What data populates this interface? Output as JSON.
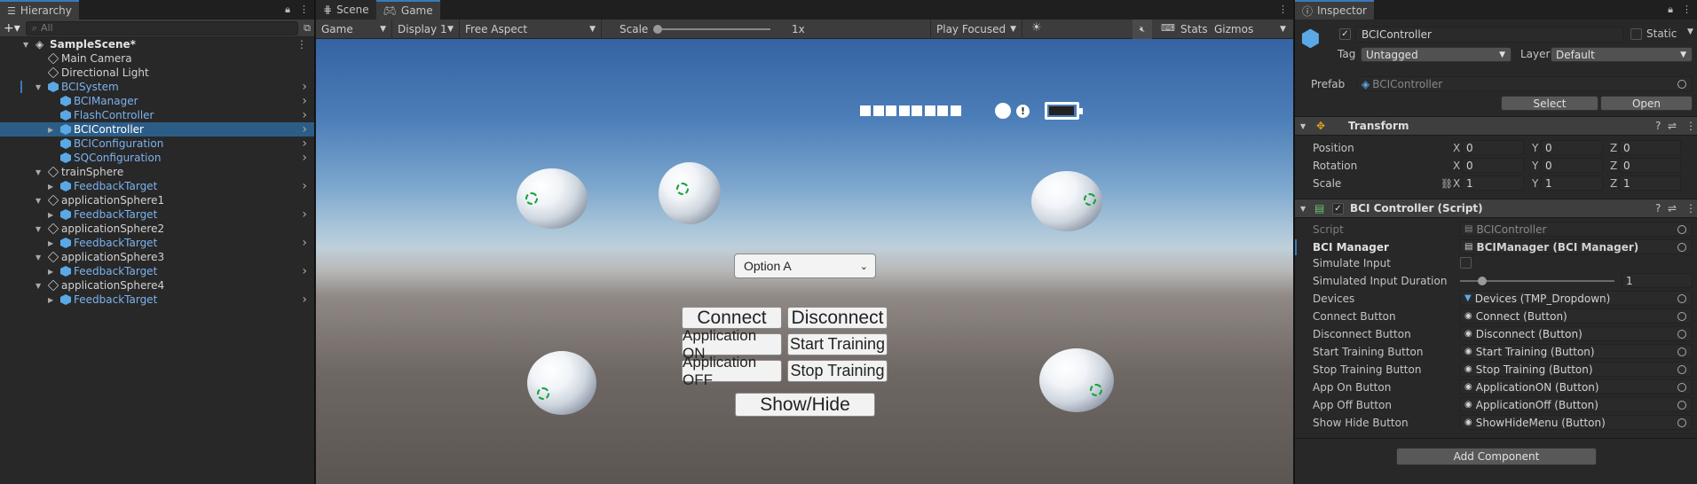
{
  "hierarchy": {
    "tab": "Hierarchy",
    "search_placeholder": "All",
    "scene": "SampleScene*",
    "items": [
      {
        "label": "Main Camera"
      },
      {
        "label": "Directional Light"
      },
      {
        "label": "BCISystem"
      },
      {
        "label": "BCIManager"
      },
      {
        "label": "FlashController"
      },
      {
        "label": "BCIController"
      },
      {
        "label": "BCIConfiguration"
      },
      {
        "label": "SQConfiguration"
      },
      {
        "label": "trainSphere"
      },
      {
        "label": "FeedbackTarget"
      },
      {
        "label": "applicationSphere1"
      },
      {
        "label": "FeedbackTarget"
      },
      {
        "label": "applicationSphere2"
      },
      {
        "label": "FeedbackTarget"
      },
      {
        "label": "applicationSphere3"
      },
      {
        "label": "FeedbackTarget"
      },
      {
        "label": "applicationSphere4"
      },
      {
        "label": "FeedbackTarget"
      }
    ]
  },
  "game": {
    "tabs": {
      "scene": "Scene",
      "game": "Game"
    },
    "toolbar": {
      "view": "Game",
      "display": "Display 1",
      "aspect": "Free Aspect",
      "scale_label": "Scale",
      "scale_value": "1x",
      "play_mode": "Play Focused",
      "stats": "Stats",
      "gizmos": "Gizmos"
    },
    "ui": {
      "dropdown": "Option A",
      "connect": "Connect",
      "disconnect": "Disconnect",
      "app_on": "Application ON",
      "start_training": "Start Training",
      "app_off": "Application OFF",
      "stop_training": "Stop Training",
      "show_hide": "Show/Hide"
    }
  },
  "inspector": {
    "tab": "Inspector",
    "object_name": "BCIController",
    "static_label": "Static",
    "tag_label": "Tag",
    "tag_value": "Untagged",
    "layer_label": "Layer",
    "layer_value": "Default",
    "prefab_label": "Prefab",
    "prefab_value": "BCIController",
    "select_btn": "Select",
    "open_btn": "Open",
    "transform": {
      "title": "Transform",
      "position": {
        "label": "Position",
        "x": "0",
        "y": "0",
        "z": "0"
      },
      "rotation": {
        "label": "Rotation",
        "x": "0",
        "y": "0",
        "z": "0"
      },
      "scale": {
        "label": "Scale",
        "x": "1",
        "y": "1",
        "z": "1"
      }
    },
    "script_comp": {
      "title": "BCI Controller (Script)",
      "fields": [
        {
          "label": "Script",
          "value": "BCIController"
        },
        {
          "label": "BCI Manager",
          "value": "BCIManager (BCI Manager)"
        },
        {
          "label": "Simulate Input",
          "value": ""
        },
        {
          "label": "Simulated Input Duration",
          "value": "1"
        },
        {
          "label": "Devices",
          "value": "Devices (TMP_Dropdown)"
        },
        {
          "label": "Connect Button",
          "value": "Connect (Button)"
        },
        {
          "label": "Disconnect Button",
          "value": "Disconnect (Button)"
        },
        {
          "label": "Start Training Button",
          "value": "Start Training (Button)"
        },
        {
          "label": "Stop Training Button",
          "value": "Stop Training (Button)"
        },
        {
          "label": "App On Button",
          "value": "ApplicationON (Button)"
        },
        {
          "label": "App Off Button",
          "value": "ApplicationOff (Button)"
        },
        {
          "label": "Show Hide Button",
          "value": "ShowHideMenu (Button)"
        }
      ]
    },
    "add_component": "Add Component"
  },
  "colors": {
    "accent": "#3a79bb",
    "selection": "#2c5d87",
    "prefab_text": "#7bb2ef",
    "target_green": "#12a43a"
  }
}
